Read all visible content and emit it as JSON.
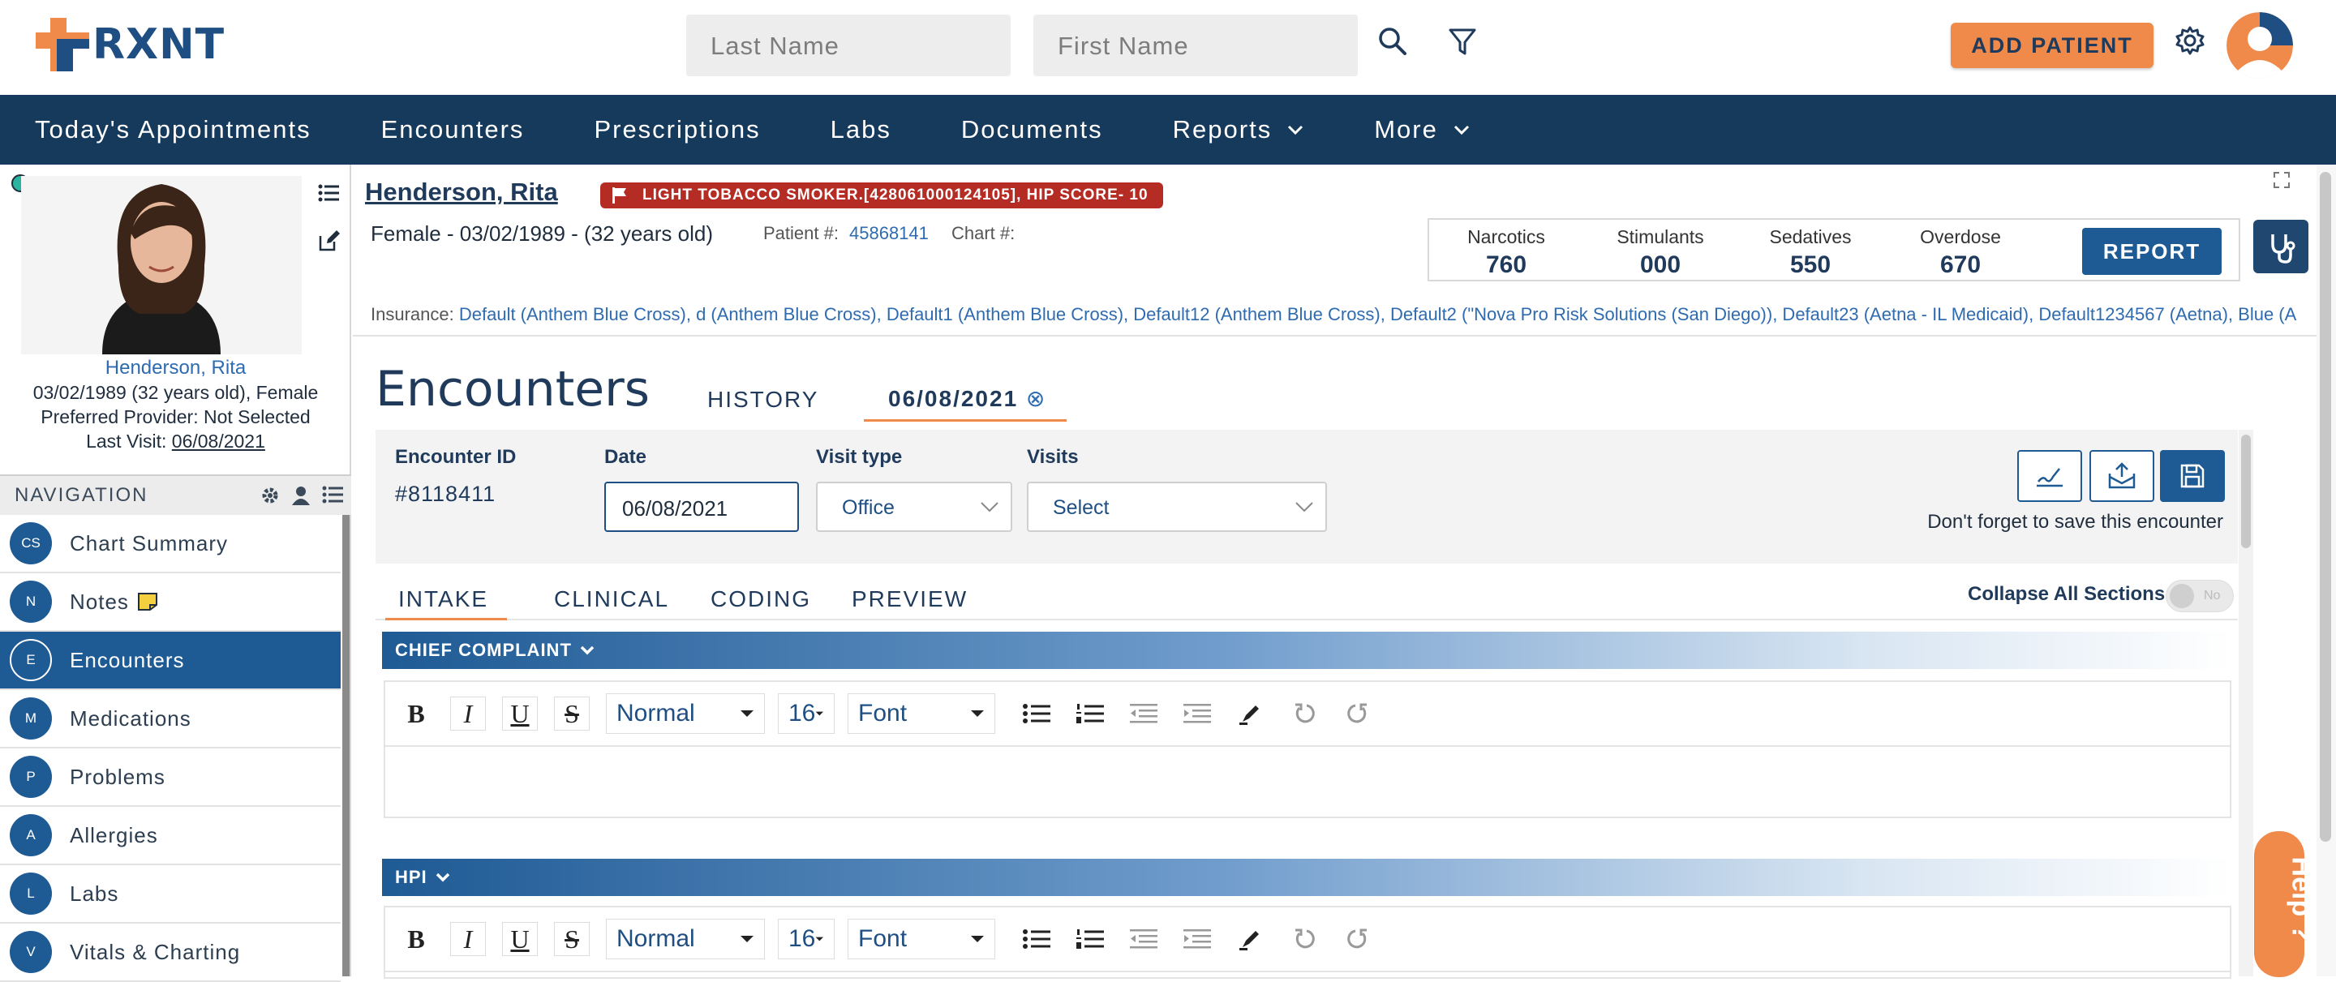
{
  "header": {
    "logo_text": "RXNT",
    "last_name_placeholder": "Last Name",
    "first_name_placeholder": "First Name",
    "add_patient_label": "ADD PATIENT",
    "accent_color": "#f08a4b",
    "brand_color": "#1f4f82"
  },
  "nav": {
    "items": [
      {
        "label": "Today's Appointments"
      },
      {
        "label": "Encounters"
      },
      {
        "label": "Prescriptions"
      },
      {
        "label": "Labs"
      },
      {
        "label": "Documents"
      },
      {
        "label": "Reports",
        "dropdown": true
      },
      {
        "label": "More",
        "dropdown": true
      }
    ]
  },
  "patient_card": {
    "name": "Henderson, Rita",
    "dob_line": "03/02/1989 (32 years old), Female",
    "provider_line": "Preferred Provider: Not Selected",
    "last_visit_label": "Last Visit:",
    "last_visit_value": "06/08/2021"
  },
  "sidebar": {
    "header": "NAVIGATION",
    "items": [
      {
        "abbr": "CS",
        "label": "Chart Summary"
      },
      {
        "abbr": "N",
        "label": "Notes"
      },
      {
        "abbr": "E",
        "label": "Encounters",
        "active": true
      },
      {
        "abbr": "M",
        "label": "Medications"
      },
      {
        "abbr": "P",
        "label": "Problems"
      },
      {
        "abbr": "A",
        "label": "Allergies"
      },
      {
        "abbr": "L",
        "label": "Labs"
      },
      {
        "abbr": "V",
        "label": "Vitals & Charting"
      }
    ]
  },
  "banner": {
    "name": "Henderson, Rita",
    "flag": "LIGHT TOBACCO SMOKER.[428061000124105], HIP SCORE- 10",
    "demographics": "Female - 03/02/1989 - (32 years old)",
    "patient_num_label": "Patient #:",
    "patient_num": "45868141",
    "chart_label": "Chart #:",
    "pdmp": [
      {
        "label": "Narcotics",
        "value": "760"
      },
      {
        "label": "Stimulants",
        "value": "000"
      },
      {
        "label": "Sedatives",
        "value": "550"
      },
      {
        "label": "Overdose",
        "value": "670"
      }
    ],
    "report_label": "REPORT",
    "insurance_label": "Insurance:",
    "insurance_value": "Default (Anthem Blue Cross), d (Anthem Blue Cross), Default1 (Anthem Blue Cross), Default12 (Anthem Blue Cross), Default2 (\"Nova Pro Risk Solutions (San Diego)), Default23 (Aetna - IL Medicaid), Default1234567 (Aetna), Blue (A"
  },
  "encounter": {
    "title": "Encounters",
    "tab_history": "HISTORY",
    "tab_date": "06/08/2021",
    "tab_close": "⊗",
    "id_label": "Encounter ID",
    "id_value": "#8118411",
    "date_label": "Date",
    "date_value": "06/08/2021",
    "visit_type_label": "Visit type",
    "visit_type_value": "Office",
    "visits_label": "Visits",
    "visits_value": "Select",
    "save_reminder": "Don't forget to save this encounter",
    "section_tabs": [
      "INTAKE",
      "CLINICAL",
      "CODING",
      "PREVIEW"
    ],
    "collapse_label": "Collapse All Sections:",
    "collapse_value": "No",
    "sections": [
      {
        "title": "CHIEF COMPLAINT"
      },
      {
        "title": "HPI"
      }
    ],
    "toolbar": {
      "style": "Normal",
      "size": "16",
      "font": "Font"
    }
  },
  "help_label": "Help ?"
}
